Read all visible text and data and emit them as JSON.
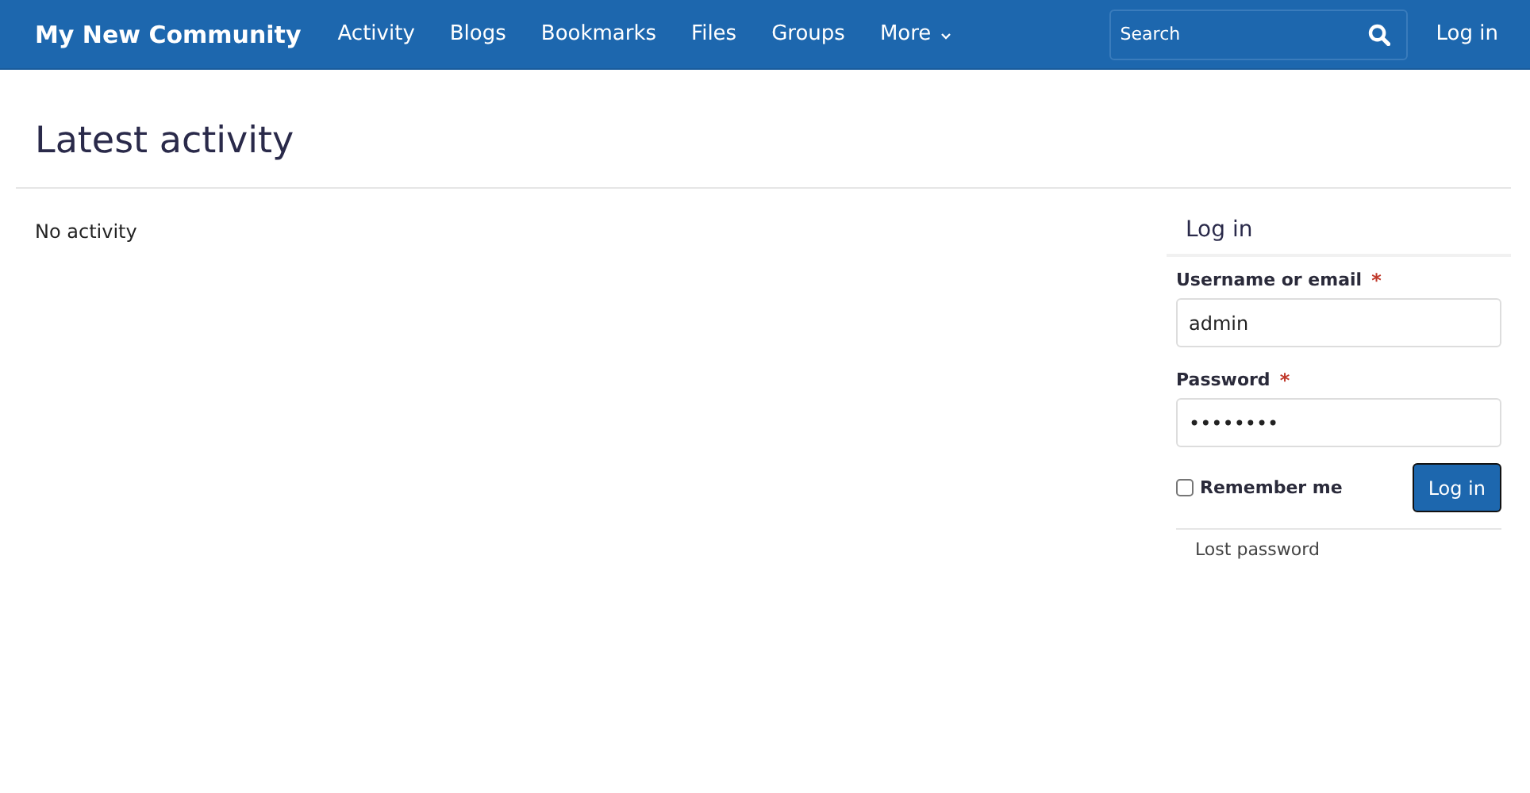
{
  "navbar": {
    "brand": "My New Community",
    "items": [
      {
        "label": "Activity",
        "dropdown": false
      },
      {
        "label": "Blogs",
        "dropdown": false
      },
      {
        "label": "Bookmarks",
        "dropdown": false
      },
      {
        "label": "Files",
        "dropdown": false
      },
      {
        "label": "Groups",
        "dropdown": false
      },
      {
        "label": "More",
        "dropdown": true
      }
    ],
    "search": {
      "placeholder": "Search"
    },
    "login_link": "Log in"
  },
  "page": {
    "title": "Latest activity",
    "empty_text": "No activity"
  },
  "login_panel": {
    "title": "Log in",
    "fields": [
      {
        "label": "Username or email",
        "required_mark": "*",
        "value": "admin"
      },
      {
        "label": "Password",
        "required_mark": "*",
        "value": "••••••••"
      }
    ],
    "remember": {
      "label": "Remember me",
      "checked": false
    },
    "submit": "Log in",
    "lost_password": "Lost password"
  }
}
